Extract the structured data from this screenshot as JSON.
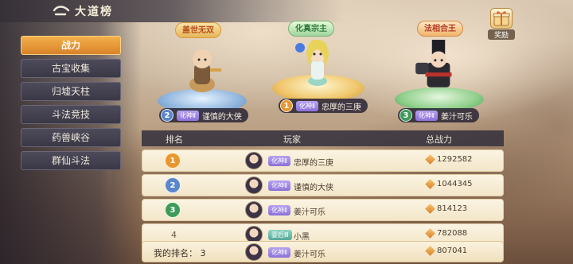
{
  "header": {
    "title": "大道榜"
  },
  "sidebar": {
    "tabs": [
      {
        "label": "战力"
      },
      {
        "label": "古宝收集"
      },
      {
        "label": "归墟天柱"
      },
      {
        "label": "斗法竞技"
      },
      {
        "label": "药兽峡谷"
      },
      {
        "label": "群仙斗法"
      }
    ],
    "active_index": 0
  },
  "podium": [
    {
      "rank": "2",
      "title": "盖世无双",
      "realm": "化神Ⅱ",
      "name": "谨慎的大侠"
    },
    {
      "rank": "1",
      "title": "化真宗主",
      "realm": "化神Ⅱ",
      "name": "忠厚的三庚"
    },
    {
      "rank": "3",
      "title": "法相合王",
      "realm": "化神Ⅱ",
      "name": "姜汁可乐"
    }
  ],
  "reward": {
    "label": "奖励"
  },
  "table": {
    "headers": {
      "rank": "排名",
      "player": "玩家",
      "power": "总战力"
    },
    "rows": [
      {
        "rank": "1",
        "realm": "化神Ⅱ",
        "name": "忠厚的三庚",
        "power": "1292582"
      },
      {
        "rank": "2",
        "realm": "化神Ⅱ",
        "name": "谨慎的大侠",
        "power": "1044345"
      },
      {
        "rank": "3",
        "realm": "化神Ⅱ",
        "name": "姜汁可乐",
        "power": "814123"
      },
      {
        "rank": "4",
        "realm": "婴后Ⅲ",
        "name": "小黑",
        "power": "782088"
      }
    ]
  },
  "my_rank": {
    "label": "我的排名：",
    "rank": "3",
    "realm": "化神Ⅱ",
    "name": "姜汁可乐",
    "power": "807041"
  },
  "colors": {
    "gold": "#e8962f",
    "silver": "#5b86c9",
    "bronze": "#3f9b5a",
    "realm": "#8b71d8",
    "active_tab": "#e6922f"
  }
}
